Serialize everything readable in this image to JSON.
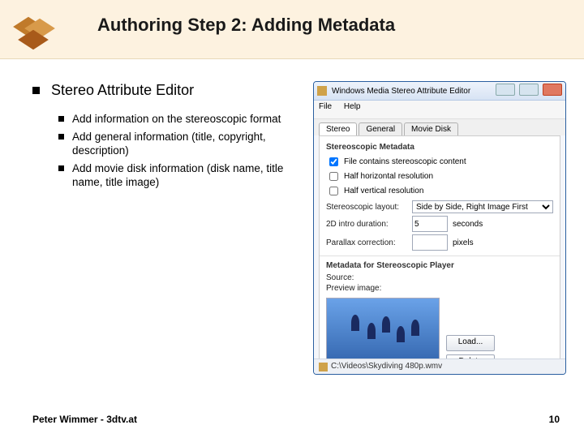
{
  "slide": {
    "title": "Authoring Step 2: Adding Metadata",
    "main_bullet": "Stereo Attribute Editor",
    "sub_bullets": [
      "Add information on the stereoscopic format",
      "Add general information (title, copyright, description)",
      "Add movie disk information (disk name, title name, title image)"
    ],
    "footer_left": "Peter Wimmer - 3dtv.at",
    "footer_right": "10"
  },
  "app": {
    "window_title": "Windows Media Stereo Attribute Editor",
    "menu": {
      "file": "File",
      "help": "Help"
    },
    "tabs": {
      "stereo": "Stereo",
      "general": "General",
      "movie_disk": "Movie Disk"
    },
    "group_meta": "Stereoscopic Metadata",
    "chk_contains": "File contains stereoscopic content",
    "chk_halfh": "Half horizontal resolution",
    "chk_halfv": "Half vertical resolution",
    "lbl_layout": "Stereoscopic layout:",
    "layout_value": "Side by Side, Right Image First",
    "lbl_intro": "2D intro duration:",
    "intro_value": "5",
    "intro_unit": "seconds",
    "lbl_parallax": "Parallax correction:",
    "parallax_value": "",
    "parallax_unit": "pixels",
    "group_player": "Metadata for Stereoscopic Player",
    "lbl_source": "Source:",
    "lbl_preview": "Preview image:",
    "btn_load": "Load...",
    "btn_delete": "Delete",
    "status_path": "C:\\Videos\\Skydiving 480p.wmv"
  }
}
